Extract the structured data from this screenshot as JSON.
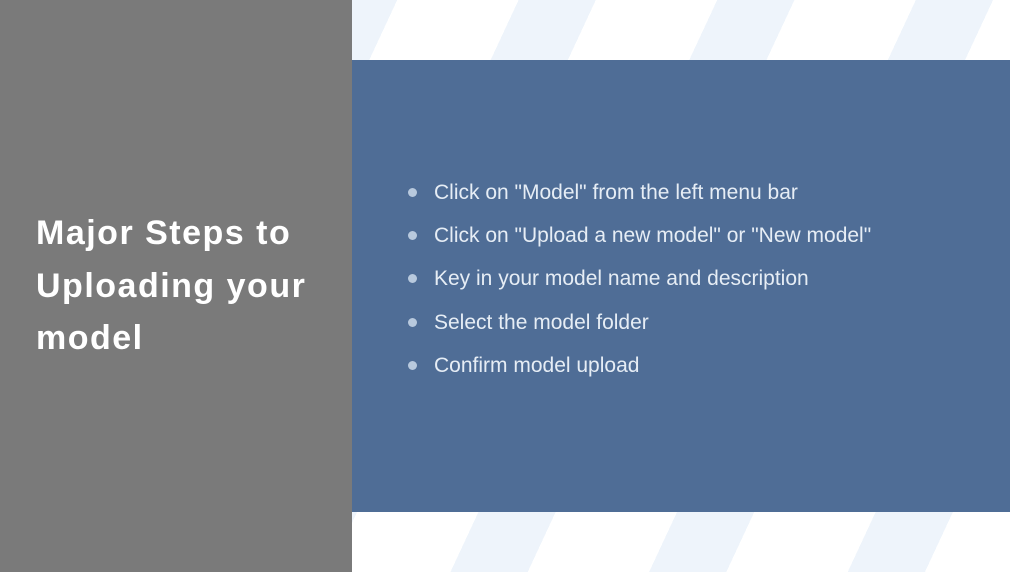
{
  "title": "Major Steps to Uploading your model",
  "steps": [
    "Click on \"Model\" from the left menu bar",
    "Click on \"Upload a new model\" or \"New model\"",
    "Key in your model name and description",
    "Select the model folder",
    "Confirm model upload"
  ]
}
